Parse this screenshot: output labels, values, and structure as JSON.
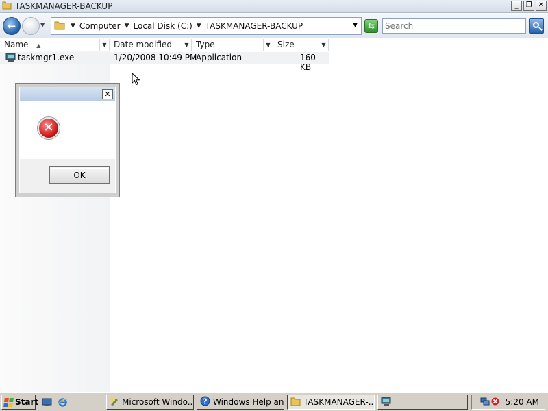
{
  "window": {
    "title": "TASKMANAGER-BACKUP"
  },
  "address": {
    "crumbs": [
      "Computer",
      "Local Disk (C:)",
      "TASKMANAGER-BACKUP"
    ],
    "search_placeholder": "Search"
  },
  "columns": {
    "name": "Name",
    "date": "Date modified",
    "type": "Type",
    "size": "Size"
  },
  "files": [
    {
      "name": "taskmgr1.exe",
      "date": "1/20/2008 10:49 PM",
      "type": "Application",
      "size": "160 KB"
    }
  ],
  "dialog": {
    "ok_label": "OK",
    "icon": "error-icon"
  },
  "taskbar": {
    "start_label": "Start",
    "tasks": [
      "Microsoft Windo...",
      "Windows Help an...",
      "TASKMANAGER-..."
    ],
    "clock": "5:20 AM"
  },
  "colors": {
    "accent": "#1f5fa8",
    "error": "#c40f0f",
    "taskbar": "#d4d0c8"
  }
}
